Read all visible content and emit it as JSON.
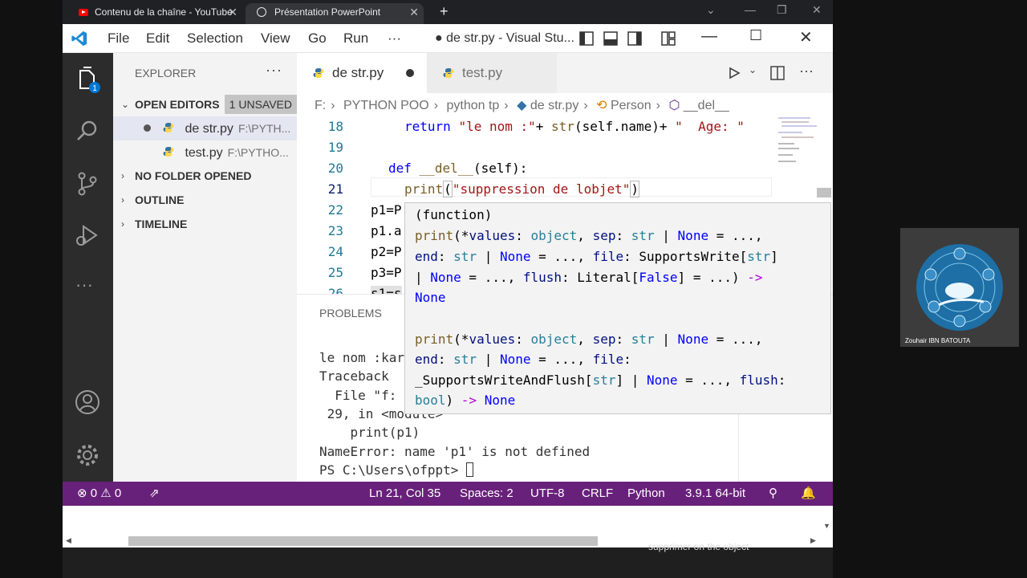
{
  "browser": {
    "tabs": [
      {
        "label": "Contenu de la chaîne - YouTube"
      },
      {
        "label": "Présentation PowerPoint"
      }
    ],
    "new_tab": "+"
  },
  "titlebar": {
    "menus": [
      "File",
      "Edit",
      "Selection",
      "View",
      "Go",
      "Run",
      "···"
    ],
    "title": "● de str.py - Visual Stu..."
  },
  "activity": {
    "badge": "1"
  },
  "sidebar": {
    "title": "EXPLORER",
    "more": "···",
    "open_editors": {
      "label": "OPEN EDITORS",
      "badge": "1 UNSAVED",
      "items": [
        {
          "name": "de str.py",
          "path": "F:\\PYTH..."
        },
        {
          "name": "test.py",
          "path": "F:\\PYTHO..."
        }
      ]
    },
    "sections": [
      "NO FOLDER OPENED",
      "OUTLINE",
      "TIMELINE"
    ]
  },
  "editor": {
    "tabs": [
      {
        "label": "de str.py",
        "dirty": true
      },
      {
        "label": "test.py",
        "dirty": false
      }
    ],
    "breadcrumb": [
      "F:",
      "PYTHON POO",
      "python tp",
      "de str.py",
      "Person",
      "__del__"
    ],
    "lines": {
      "l18": {
        "no": "18",
        "kw": "return",
        "s1": "\"le nom :\"",
        "mid": "+ ",
        "fn": "str",
        "rest": "(self.name)+ ",
        "s2": "\"  Age: \""
      },
      "l19": {
        "no": "19"
      },
      "l20": {
        "no": "20",
        "kw": "def",
        "fn": "__del__",
        "rest": "(self):"
      },
      "l21": {
        "no": "21",
        "fn": "print",
        "open": "(",
        "str": "\"suppression de lobjet\"",
        "close": ")"
      },
      "l22": {
        "no": "22",
        "text": "p1=P"
      },
      "l23": {
        "no": "23",
        "text": "p1.a"
      },
      "l24": {
        "no": "24",
        "text": "p2=P"
      },
      "l25": {
        "no": "25",
        "text": "p3=P"
      },
      "l26": {
        "no": "26",
        "text": "s1=s"
      }
    }
  },
  "hover": {
    "kind": "(function)",
    "sig1": {
      "a_fn": "print",
      "a_1": "(*",
      "a_p1": "values",
      "a_2": ": ",
      "a_t1": "object",
      "a_3": ", ",
      "a_p2": "sep",
      "a_4": ": ",
      "a_t2": "str",
      "a_5": " | ",
      "a_t3": "None",
      "a_6": " = ...,",
      "b_p1": "end",
      "b_1": ": ",
      "b_t1": "str",
      "b_2": " | ",
      "b_t2": "None",
      "b_3": " = ..., ",
      "b_p2": "file",
      "b_4": ": ",
      "b_t3": "SupportsWrite",
      "b_5": "[",
      "b_t4": "str",
      "b_6": "]",
      "c_1": "| ",
      "c_t1": "None",
      "c_2": " = ..., ",
      "c_p1": "flush",
      "c_3": ": ",
      "c_t2": "Literal",
      "c_4": "[",
      "c_t3": "False",
      "c_5": "] = ...) ",
      "c_ar": "->",
      "d_t1": "None"
    },
    "sig2": {
      "a_fn": "print",
      "a_1": "(*",
      "a_p1": "values",
      "a_2": ": ",
      "a_t1": "object",
      "a_3": ", ",
      "a_p2": "sep",
      "a_4": ": ",
      "a_t2": "str",
      "a_5": " | ",
      "a_t3": "None",
      "a_6": " = ...,",
      "b_p1": "end",
      "b_1": ": ",
      "b_t1": "str",
      "b_2": " | ",
      "b_t2": "None",
      "b_3": " = ..., ",
      "b_p2": "file",
      "b_4": ":",
      "c_t1": "_SupportsWriteAndFlush",
      "c_1": "[",
      "c_t2": "str",
      "c_2": "] | ",
      "c_t3": "None",
      "c_3": " = ..., ",
      "c_p1": "flush",
      "c_4": ":",
      "d_t1": "bool",
      "d_1": ") ",
      "d_ar": "->",
      "d_2": " ",
      "d_t2": "None"
    }
  },
  "panel": {
    "tab": "PROBLEMS",
    "lines": [
      "le nom :kar",
      "Traceback",
      "  File \"f:",
      " 29, in <module>",
      "    print(p1)",
      "NameError: name 'p1' is not defined",
      "PS C:\\Users\\ofppt> "
    ]
  },
  "statusbar": {
    "errors": "0",
    "warnings": "0",
    "position": "Ln 21, Col 35",
    "spaces": "Spaces: 2",
    "encoding": "UTF-8",
    "eol": "CRLF",
    "language": "Python",
    "interpreter": "3.9.1 64-bit"
  },
  "webcam": {
    "name": "Zouhair IBN BATOUTA"
  },
  "caption": "supprimer on the object",
  "colors": {
    "statusbar": "#68217a",
    "keyword": "#0000ff",
    "string": "#a31515",
    "function": "#795e26",
    "type": "#267f99"
  }
}
